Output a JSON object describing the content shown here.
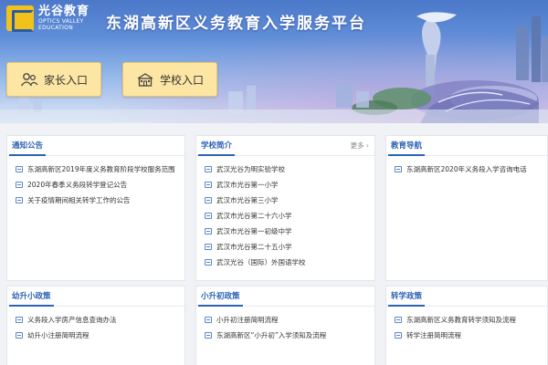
{
  "header": {
    "logo_cn": "光谷教育",
    "logo_en_1": "OPTICS VALLEY",
    "logo_en_2": "EDUCATION",
    "title": "东湖高新区义务教育入学服务平台",
    "parent_entry": "家长入口",
    "school_entry": "学校入口"
  },
  "panels": {
    "notice": {
      "title": "通知公告",
      "items": [
        "东湖高新区2019年度义务教育阶段学校服务范围",
        "2020年春季义务段转学登记公告",
        "关于疫情期间相关转学工作的公告"
      ]
    },
    "school": {
      "title": "学校简介",
      "more": "更多 ›",
      "items": [
        "武汉光谷为明实验学校",
        "武汉市光谷第一小学",
        "武汉市光谷第三小学",
        "武汉市光谷第二十六小学",
        "武汉市光谷第一初级中学",
        "武汉市光谷第二十五小学",
        "武汉光谷（国际）外国语学校"
      ]
    },
    "guide": {
      "title": "教育导航",
      "items": [
        "东湖高新区2020年义务段入学咨询电话"
      ]
    },
    "k2p": {
      "title": "幼升小政策",
      "items": [
        "义务段入学房产信息查询办法",
        "幼升小注册简明流程"
      ]
    },
    "p2m": {
      "title": "小升初政策",
      "items": [
        "小升初注册简明流程",
        "东湖高新区“小升初”入学须知及流程"
      ]
    },
    "transfer": {
      "title": "转学政策",
      "items": [
        "东湖高新区义务教育转学须知及流程",
        "转学注册简明流程"
      ]
    }
  },
  "colors": {
    "accent": "#2d63b4",
    "entry_button": "#fde6a3"
  }
}
